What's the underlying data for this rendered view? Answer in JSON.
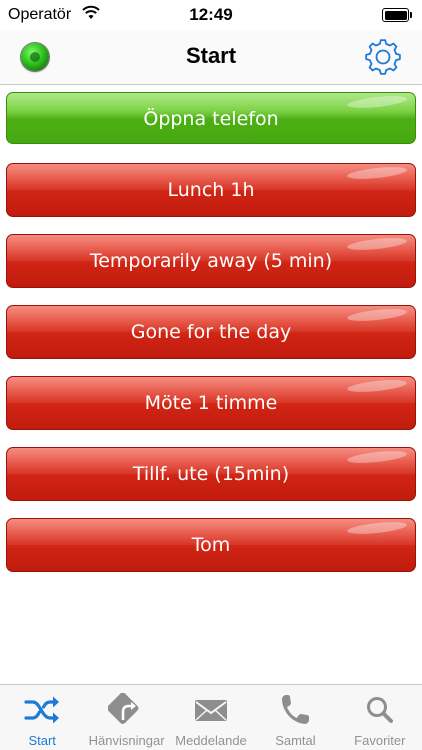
{
  "status_bar": {
    "carrier": "Operatör",
    "time": "12:49"
  },
  "nav": {
    "title": "Start",
    "status_color": "#2fbf1f"
  },
  "actions": [
    {
      "label": "Öppna telefon",
      "color": "green"
    },
    {
      "label": "Lunch 1h",
      "color": "red"
    },
    {
      "label": "Temporarily away (5 min)",
      "color": "red"
    },
    {
      "label": "Gone for the day",
      "color": "red"
    },
    {
      "label": "Möte 1 timme",
      "color": "red"
    },
    {
      "label": "Tillf. ute (15min)",
      "color": "red"
    },
    {
      "label": "Tom",
      "color": "red"
    }
  ],
  "tabs": [
    {
      "label": "Start",
      "icon": "shuffle-icon",
      "active": true
    },
    {
      "label": "Hänvisningar",
      "icon": "turn-sign-icon",
      "active": false
    },
    {
      "label": "Meddelande",
      "icon": "envelope-icon",
      "active": false
    },
    {
      "label": "Samtal",
      "icon": "phone-icon",
      "active": false
    },
    {
      "label": "Favoriter",
      "icon": "search-icon",
      "active": false
    }
  ],
  "colors": {
    "accent": "#1e7ad6",
    "inactive_tab": "#929292",
    "green_button": "#4cb014",
    "red_button": "#d02414"
  }
}
